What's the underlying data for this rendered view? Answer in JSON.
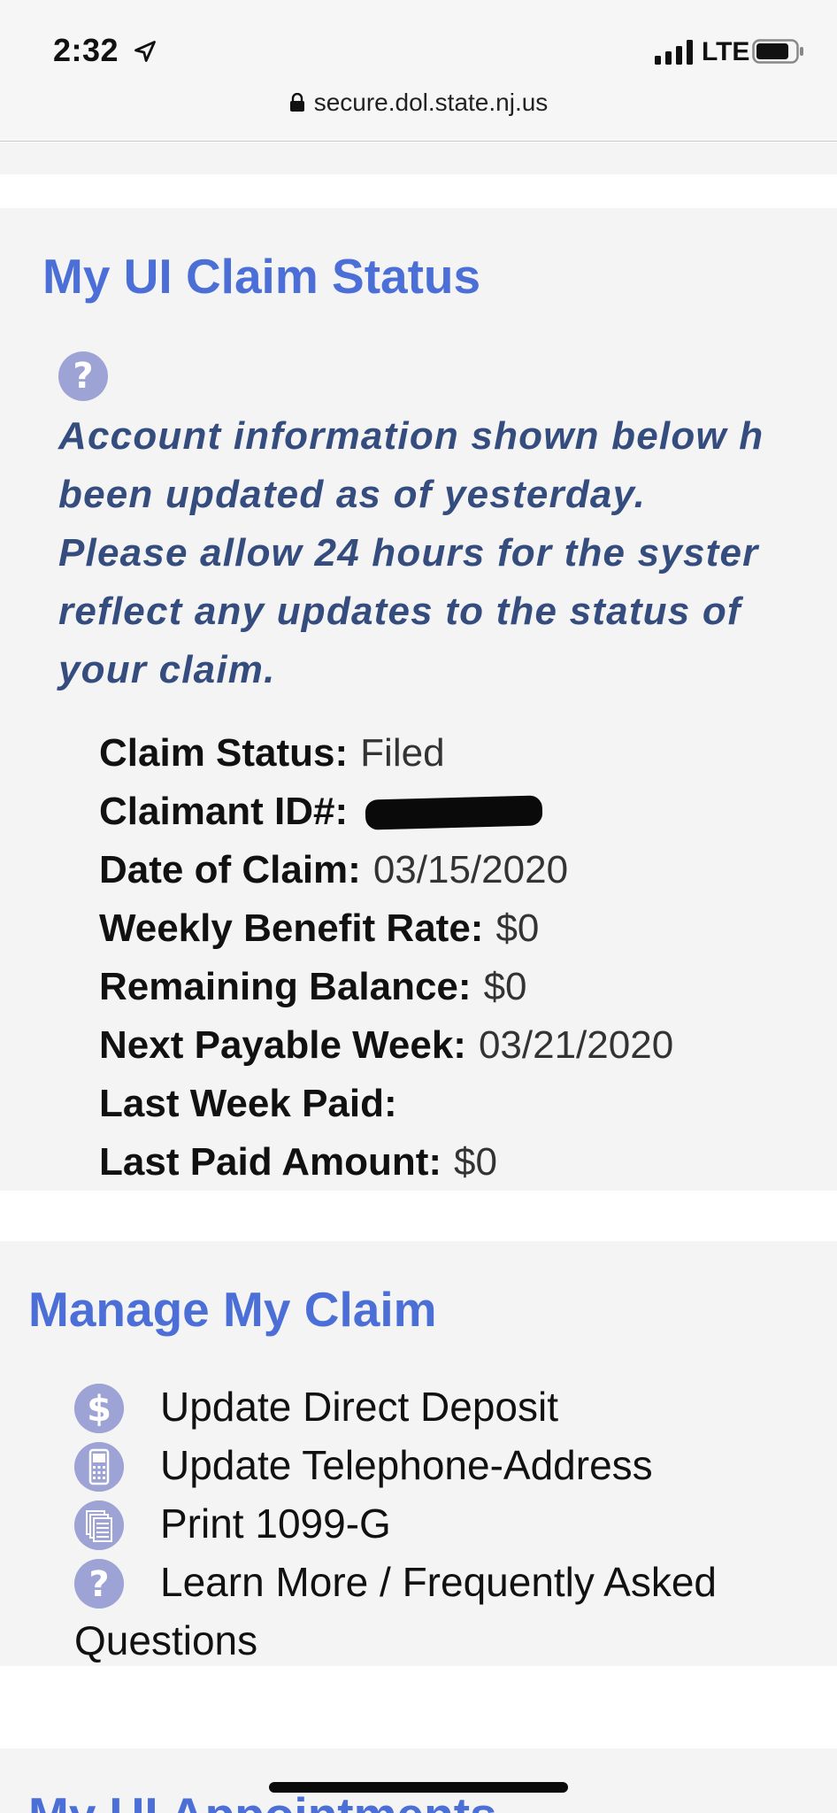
{
  "status_bar": {
    "time": "2:32",
    "network": "LTE",
    "url": "secure.dol.state.nj.us"
  },
  "claim_status": {
    "title": "My UI Claim Status",
    "notice_lines": [
      "Account information shown below h",
      "been updated as of yesterday.",
      "Please allow 24 hours for the syster",
      "reflect any updates to the status of",
      "your claim."
    ],
    "rows": [
      {
        "label": "Claim Status:",
        "value": "Filed"
      },
      {
        "label": "Claimant ID#:",
        "value": ""
      },
      {
        "label": "Date of Claim:",
        "value": "03/15/2020"
      },
      {
        "label": "Weekly Benefit Rate:",
        "value": "$0"
      },
      {
        "label": "Remaining Balance:",
        "value": "$0"
      },
      {
        "label": "Next Payable Week:",
        "value": "03/21/2020"
      },
      {
        "label": "Last Week Paid:",
        "value": ""
      },
      {
        "label": "Last Paid Amount:",
        "value": "$0"
      }
    ]
  },
  "manage": {
    "title": "Manage My Claim",
    "items": [
      {
        "label": "Update Direct Deposit",
        "icon": "dollar-icon"
      },
      {
        "label": "Update Telephone-Address",
        "icon": "phone-icon"
      },
      {
        "label": "Print 1099-G",
        "icon": "documents-icon"
      },
      {
        "label": "Learn More / Frequently Asked",
        "icon": "question-icon"
      }
    ],
    "faq_wrap": "Questions"
  },
  "appointments": {
    "title": "My UI Appointments"
  },
  "colors": {
    "heading_blue": "#4b6fd6",
    "notice_navy": "#354d7e",
    "icon_lavender": "#9ea3d6",
    "card_bg": "#f4f4f5"
  }
}
